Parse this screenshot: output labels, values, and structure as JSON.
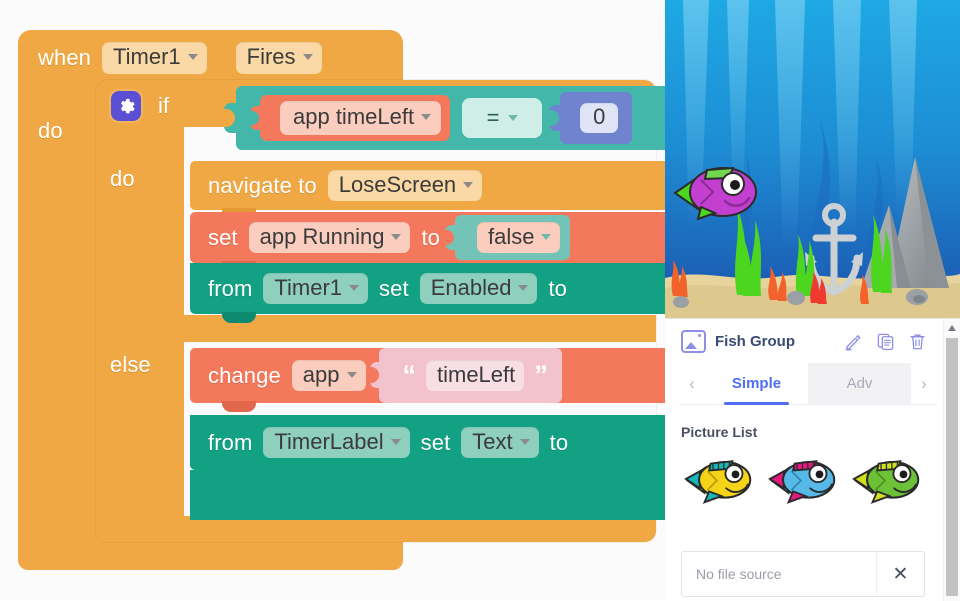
{
  "blocks": {
    "event": {
      "when": "when",
      "component": "Timer1",
      "event": "Fires",
      "do": "do"
    },
    "if_block": {
      "gear_icon": "gear-icon",
      "if": "if",
      "do": "do",
      "else": "else",
      "condition": {
        "getter": "app timeLeft",
        "operator": "=",
        "value": "0"
      }
    },
    "then_statements": [
      {
        "kw1": "navigate to",
        "field1": "LoseScreen"
      },
      {
        "kw1": "set",
        "field1": "app Running",
        "kw2": "to",
        "value": "false"
      },
      {
        "kw1": "from",
        "field1": "Timer1",
        "kw2": "set",
        "field2": "Enabled",
        "kw3": "to"
      }
    ],
    "else_statements": [
      {
        "kw1": "change",
        "field1": "app",
        "text_value": "timeLeft",
        "quote_open": "“",
        "quote_close": "”"
      },
      {
        "kw1": "from",
        "field1": "TimerLabel",
        "kw2": "set",
        "field2": "Text",
        "kw3": "to"
      }
    ],
    "colors": {
      "control_orange": "#f0a845",
      "variable_salmon": "#f4785c",
      "logic_teal": "#44b7ab",
      "component_green": "#13a183",
      "math_blue": "#6f83cf",
      "text_pink": "#f2c2cd",
      "gear_purple": "#5b4fd4"
    }
  },
  "preview": {
    "name": "underwater-scene",
    "description": "Underwater background with purple fish, seaweed, anchor and rock",
    "colors": {
      "water_top": "#1ea2e0",
      "water_bottom": "#1f5fb5",
      "sand": "#e9d7a0",
      "seaweed": "#4fd62b",
      "fish_body": "#c23fd0",
      "rock": "#9ea3a8",
      "anchor": "#cfd3d6",
      "coral": "#f2622a"
    }
  },
  "panel": {
    "title": "Fish Group",
    "title_icon": "picture-icon",
    "actions": [
      {
        "name": "edit-icon",
        "label": "Edit"
      },
      {
        "name": "duplicate-icon",
        "label": "Duplicate"
      },
      {
        "name": "delete-icon",
        "label": "Delete"
      }
    ],
    "tabs": {
      "prev": "‹",
      "next": "›",
      "items": [
        {
          "label": "Simple",
          "active": true
        },
        {
          "label": "Adv",
          "active": false
        }
      ]
    },
    "picture_list": {
      "label": "Picture List",
      "items": [
        {
          "name": "fish-yellow",
          "body": "#f5d316",
          "fin": "#18b7b7",
          "hat": "#18b7b7",
          "line": "#2a2a2a"
        },
        {
          "name": "fish-blue",
          "body": "#57b9e8",
          "fin": "#e5197f",
          "hat": "#e5197f",
          "line": "#2a2a2a"
        },
        {
          "name": "fish-green",
          "body": "#6cc137",
          "fin": "#cfe01e",
          "hat": "#cfe01e",
          "line": "#2a2a2a"
        }
      ]
    },
    "file_source": {
      "placeholder": "No file source",
      "value": "",
      "clear_label": "✕"
    },
    "scrollbar": {
      "up_arrow": "▲"
    }
  }
}
